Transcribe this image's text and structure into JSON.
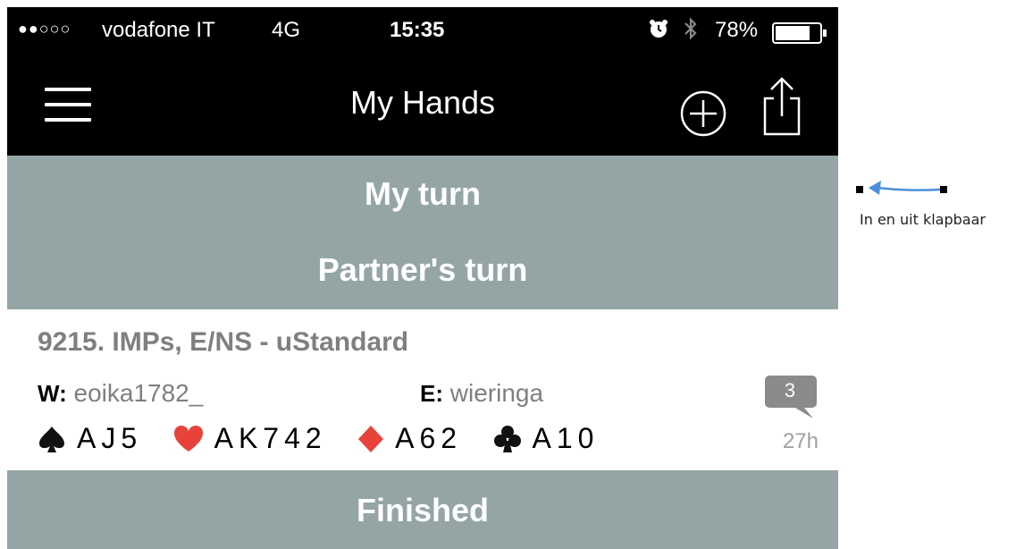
{
  "status_bar": {
    "signal": "●●○○○",
    "carrier": "vodafone IT",
    "network": "4G",
    "time": "15:35",
    "battery": "78%",
    "icons": [
      "alarm-icon",
      "bluetooth-icon",
      "battery-icon"
    ]
  },
  "nav": {
    "title": "My Hands",
    "icons": [
      "menu-icon",
      "add-icon",
      "share-icon"
    ]
  },
  "sections": {
    "my_turn": "My turn",
    "partners_turn": "Partner's turn",
    "finished": "Finished"
  },
  "hand": {
    "title": "9215. IMPs, E/NS - uStandard",
    "west_label": "W:",
    "west_player": "eoika1782_",
    "east_label": "E:",
    "east_player": "wieringa",
    "chat_count": "3",
    "elapsed": "27h",
    "suits": [
      {
        "icon": "spade-icon",
        "color": "#111111",
        "cards": "AJ5"
      },
      {
        "icon": "heart-icon",
        "color": "#e8433a",
        "cards": "AK742"
      },
      {
        "icon": "diamond-icon",
        "color": "#e8433a",
        "cards": "A62"
      },
      {
        "icon": "club-icon",
        "color": "#111111",
        "cards": "A10"
      }
    ]
  },
  "annotation": {
    "text": "In en uit klapbaar",
    "arrow_color": "#4a90d9"
  },
  "colors": {
    "section_bg": "#95a5a6",
    "bar_bg": "#000000"
  }
}
